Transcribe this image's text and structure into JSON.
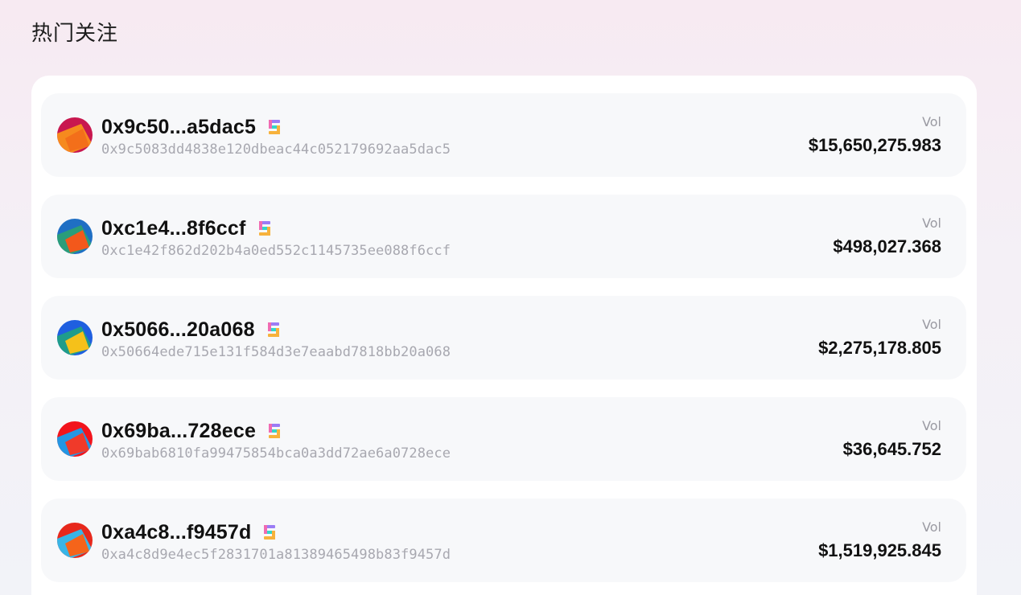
{
  "section_title": "热门关注",
  "volume_label": "Vol",
  "wallets": [
    {
      "short_address": "0x9c50...a5dac5",
      "full_address": "0x9c5083dd4838e120dbeac44c052179692aa5dac5",
      "volume": "$15,650,275.983",
      "avatar_colors": [
        "#c8174f",
        "#f68a1e",
        "#f36f1a"
      ]
    },
    {
      "short_address": "0xc1e4...8f6ccf",
      "full_address": "0xc1e42f862d202b4a0ed552c1145735ee088f6ccf",
      "volume": "$498,027.368",
      "avatar_colors": [
        "#1f6fc4",
        "#2a9d7a",
        "#f3581b"
      ]
    },
    {
      "short_address": "0x5066...20a068",
      "full_address": "0x50664ede715e131f584d3e7eaabd7818bb20a068",
      "volume": "$2,275,178.805",
      "avatar_colors": [
        "#1f5fe0",
        "#1f9c8a",
        "#f5c11a"
      ]
    },
    {
      "short_address": "0x69ba...728ece",
      "full_address": "0x69bab6810fa99475854bca0a3dd72ae6a0728ece",
      "volume": "$36,645.752",
      "avatar_colors": [
        "#f2141c",
        "#2496e3",
        "#f03a2a"
      ]
    },
    {
      "short_address": "0xa4c8...f9457d",
      "full_address": "0xa4c8d9e4ec5f2831701a81389465498b83f9457d",
      "volume": "$1,519,925.845",
      "avatar_colors": [
        "#e7281c",
        "#39b5e6",
        "#f5641a"
      ]
    }
  ],
  "chain_icon": "solana-icon",
  "chain_icon_colors": [
    "#9b7cf5",
    "#34d6c9",
    "#f7b23c",
    "#f06bb2"
  ]
}
